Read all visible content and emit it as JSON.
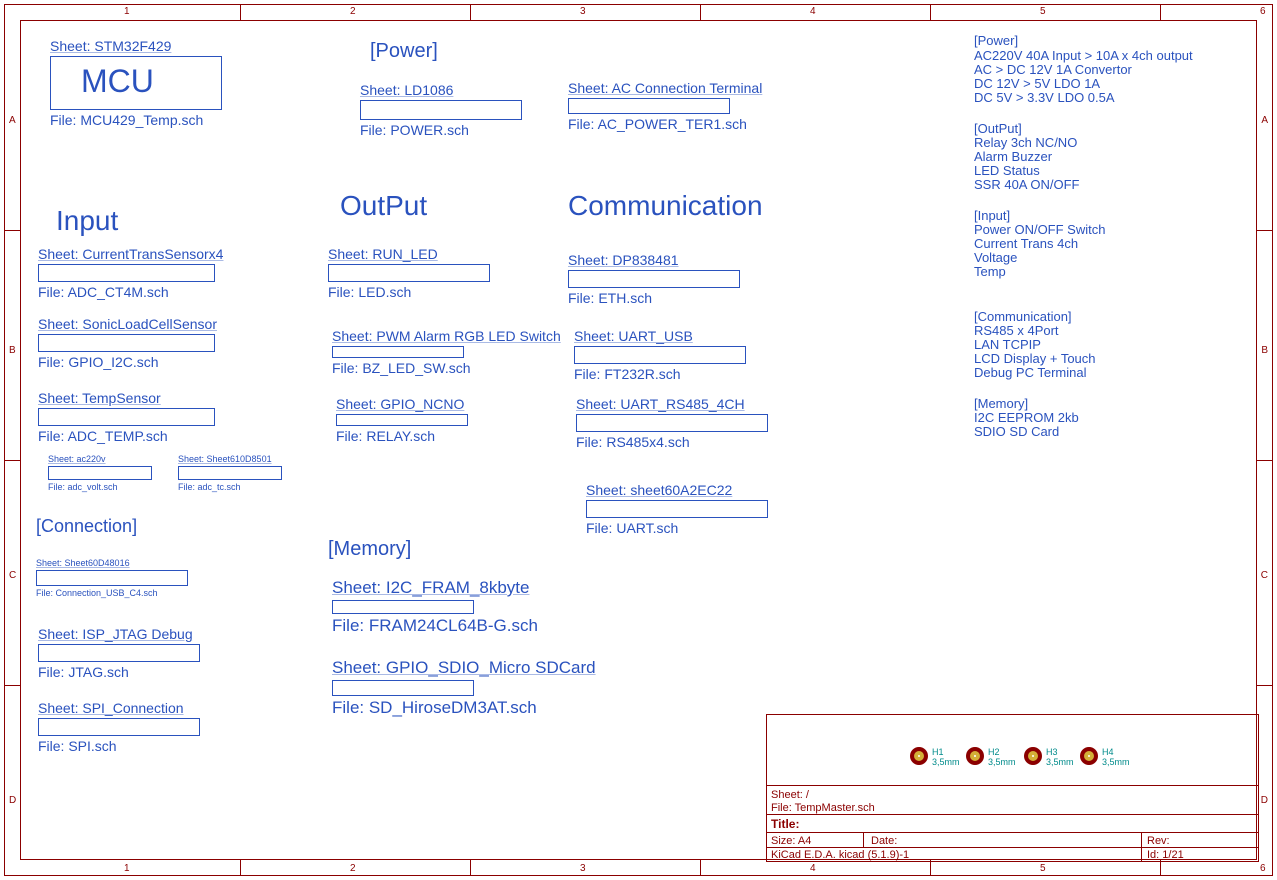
{
  "ruler": {
    "cols": [
      "1",
      "2",
      "3",
      "4",
      "5",
      "6"
    ],
    "rows": [
      "A",
      "B",
      "C",
      "D"
    ]
  },
  "mcu_big": "MCU",
  "sections": {
    "power_hdr": "[Power]",
    "input_hdr": "Input",
    "output_hdr": "OutPut",
    "comm_hdr": "Communication",
    "connection_hdr": "[Connection]",
    "memory_hdr": "[Memory]"
  },
  "sheets": {
    "mcu": {
      "title": "Sheet: STM32F429",
      "file": "File: MCU429_Temp.sch"
    },
    "ld1086": {
      "title": "Sheet: LD1086",
      "file": "File: POWER.sch"
    },
    "ac_term": {
      "title": "Sheet: AC Connection Terminal",
      "file": "File: AC_POWER_TER1.sch"
    },
    "ctx4": {
      "title": "Sheet: CurrentTransSensorx4",
      "file": "File: ADC_CT4M.sch"
    },
    "sonic": {
      "title": "Sheet: SonicLoadCellSensor",
      "file": "File: GPIO_I2C.sch"
    },
    "temp": {
      "title": "Sheet: TempSensor",
      "file": "File: ADC_TEMP.sch"
    },
    "ac220v": {
      "title": "Sheet: ac220v",
      "file": "File: adc_volt.sch"
    },
    "sheet0501": {
      "title": "Sheet: Sheet610D8501",
      "file": "File: adc_tc.sch"
    },
    "runled": {
      "title": "Sheet: RUN_LED",
      "file": "File: LED.sch"
    },
    "pwmrgb": {
      "title": "Sheet: PWM Alarm RGB LED Switch",
      "file": "File: BZ_LED_SW.sch"
    },
    "gpioncno": {
      "title": "Sheet: GPIO_NCNO",
      "file": "File: RELAY.sch"
    },
    "dp8384": {
      "title": "Sheet: DP838481",
      "file": "File: ETH.sch"
    },
    "uartusb": {
      "title": "Sheet: UART_USB",
      "file": "File: FT232R.sch"
    },
    "uart485": {
      "title": "Sheet: UART_RS485_4CH",
      "file": "File: RS485x4.sch"
    },
    "sheetEC22": {
      "title": "Sheet: sheet60A2EC22",
      "file": "File: UART.sch"
    },
    "conn8016": {
      "title": "Sheet: Sheet60D48016",
      "file": "File: Connection_USB_C4.sch"
    },
    "jtag": {
      "title": "Sheet: ISP_JTAG Debug",
      "file": "File: JTAG.sch"
    },
    "spi": {
      "title": "Sheet: SPI_Connection",
      "file": "File: SPI.sch"
    },
    "fram": {
      "title": "Sheet: I2C_FRAM_8kbyte",
      "file": "File: FRAM24CL64B-G.sch"
    },
    "sdio": {
      "title": "Sheet: GPIO_SDIO_Micro SDCard",
      "file": "File: SD_HiroseDM3AT.sch"
    }
  },
  "notes": {
    "power_h": "[Power]",
    "power_l1": "AC220V 40A Input > 10A x 4ch output",
    "power_l2": "AC > DC 12V 1A Convertor",
    "power_l3": "DC 12V > 5V LDO 1A",
    "power_l4": "DC 5V > 3.3V LDO 0.5A",
    "out_h": "[OutPut]",
    "out_l1": "Relay 3ch NC/NO",
    "out_l2": "Alarm Buzzer",
    "out_l3": "LED Status",
    "out_l4": "SSR 40A ON/OFF",
    "in_h": "[Input]",
    "in_l1": "Power ON/OFF Switch",
    "in_l2": "Current Trans 4ch",
    "in_l3": "Voltage",
    "in_l4": "Temp",
    "comm_h": "[Communication]",
    "comm_l1": "RS485 x 4Port",
    "comm_l2": "LAN TCPIP",
    "comm_l3": "LCD Display + Touch",
    "comm_l4": "Debug PC Terminal",
    "mem_h": "[Memory]",
    "mem_l1": "I2C EEPROM 2kb",
    "mem_l2": "SDIO SD Card"
  },
  "holes": {
    "h1": {
      "ref": "H1",
      "val": "3,5mm"
    },
    "h2": {
      "ref": "H2",
      "val": "3,5mm"
    },
    "h3": {
      "ref": "H3",
      "val": "3,5mm"
    },
    "h4": {
      "ref": "H4",
      "val": "3,5mm"
    }
  },
  "title_block": {
    "sheet": "Sheet: /",
    "file": "File: TempMaster.sch",
    "title_lbl": "Title:",
    "size": "Size: A4",
    "date": "Date:",
    "rev": "Rev:",
    "tool": "KiCad E.D.A.  kicad (5.1.9)-1",
    "id": "Id: 1/21"
  }
}
